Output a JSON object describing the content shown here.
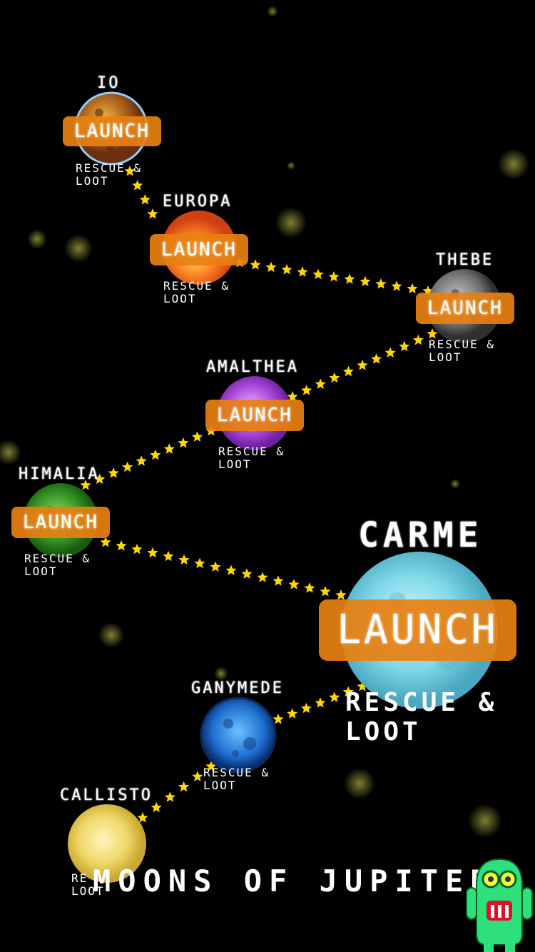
{
  "moons": [
    {
      "name": "IO",
      "launch": "LAUNCH",
      "rescue": "RESCUE &",
      "loot": "LOOT"
    },
    {
      "name": "EUROPA",
      "launch": "LAUNCH",
      "rescue": "RESCUE &",
      "loot": "LOOT"
    },
    {
      "name": "THEBE",
      "launch": "LAUNCH",
      "rescue": "RESCUE &",
      "loot": "LOOT"
    },
    {
      "name": "AMALTHEA",
      "launch": "LAUNCH",
      "rescue": "RESCUE &",
      "loot": "LOOT"
    },
    {
      "name": "HIMALIA",
      "launch": "LAUNCH",
      "rescue": "RESCUE &",
      "loot": "LOOT"
    },
    {
      "name": "CARME",
      "launch": "LAUNCH",
      "rescue": "RESCUE &",
      "loot": "LOOT"
    },
    {
      "name": "GANYMEDE",
      "rescue": "RESCUE &",
      "loot": "LOOT"
    },
    {
      "name": "CALLISTO",
      "rescue": "RE",
      "loot": "LOOT"
    }
  ],
  "title": "MOONS OF JUPITER",
  "colors": {
    "launch": "#e88010",
    "star": "#ffd700"
  },
  "icons": {
    "mascot": "green-robot-icon"
  }
}
